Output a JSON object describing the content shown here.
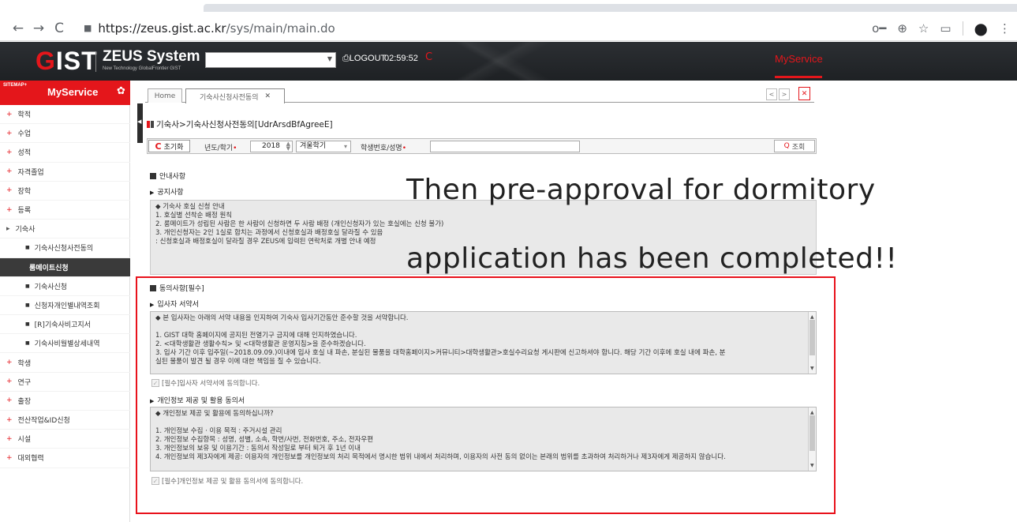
{
  "browser": {
    "url_host": "https://zeus.gist.ac.kr",
    "url_path": "/sys/main/main.do",
    "nav": {
      "back": "←",
      "forward": "→",
      "reload": "C"
    },
    "icons": {
      "key": "o━",
      "zoom": "⊕",
      "star": "☆",
      "cast": "▭",
      "account": "●",
      "menu": "⋮"
    }
  },
  "header": {
    "logo_g": "G",
    "logo_rest": "IST",
    "system_name": "ZEUS System",
    "system_sub": "New Technology GlobalFrontier GIST",
    "logout": "⎙LOGOUT",
    "timer": "02:59:52",
    "refresh_icon": "C",
    "myservice": "MyService"
  },
  "sidebar": {
    "sitemap": "SITEMAP+",
    "title": "MyService",
    "gear": "✿",
    "items": [
      {
        "label": "학적",
        "mark": "+"
      },
      {
        "label": "수업",
        "mark": "+"
      },
      {
        "label": "성적",
        "mark": "+"
      },
      {
        "label": "자격졸업",
        "mark": "+"
      },
      {
        "label": "장학",
        "mark": "+"
      },
      {
        "label": "등록",
        "mark": "+"
      },
      {
        "label": "기숙사",
        "mark": "▸"
      },
      {
        "label": "기숙사신청사전동의",
        "mark": "■"
      },
      {
        "label": "룸메이트신청",
        "mark": ""
      },
      {
        "label": "기숙사신청",
        "mark": "■"
      },
      {
        "label": "신청자개인별내역조회",
        "mark": "■"
      },
      {
        "label": "[R]기숙사비고지서",
        "mark": "■"
      },
      {
        "label": "기숙사비월별상세내역",
        "mark": "■"
      },
      {
        "label": "학생",
        "mark": "+"
      },
      {
        "label": "연구",
        "mark": "+"
      },
      {
        "label": "출장",
        "mark": "+"
      },
      {
        "label": "전산작업&ID신청",
        "mark": "+"
      },
      {
        "label": "시설",
        "mark": "+"
      },
      {
        "label": "대외협력",
        "mark": "+"
      }
    ]
  },
  "tabs": {
    "home": "Home",
    "active": "기숙사신청사전동의",
    "close": "✕",
    "prev": "<",
    "next": ">",
    "close_all": "✕"
  },
  "page": {
    "title": "기숙사>기숙사신청사전동의[UdrArsdBfAgreeE]",
    "reset": "초기화",
    "reset_icon": "C",
    "year_label": "년도/학기",
    "year_value": "2018",
    "term_value": "겨울학기",
    "student_label": "학생번호/성명",
    "search": "조회",
    "search_icon": "Q",
    "required_mark": "•"
  },
  "notice": {
    "section": "안내사항",
    "sub": "공지사항",
    "lines": [
      "◆ 기숙사 호실 신청 안내",
      "1. 호실별 선착순 배정 원칙",
      "2. 룸메이트가 성립된 사람은 한 사람이 신청하면 두 사람 배정 (개인신청자가 있는 호실에는 신청 불가)",
      "3. 개인신청자는 2인 1실로 합치는 과정에서 신청호실과 배정호실 달라질 수 있음",
      "   : 신청호실과 배정호실이 달라질 경우 ZEUS에 입력된 연락처로 개별 안내 예정"
    ]
  },
  "overlay": {
    "line1": "Then pre-approval for dormitory",
    "line2": "application has been completed!!"
  },
  "agreement": {
    "section": "동의사항[필수]",
    "pledge_sub": "입사자 서약서",
    "pledge_lines": [
      "◆ 본 입사자는 아래의 서약 내용을 인지하여 기숙사 입사기간동안 준수할 것을 서약합니다.",
      "",
      "1. GIST 대학 홈페이지에 공지된 전열기구 금지에 대해 인지하였습니다.",
      "2. <대학생활관 생활수칙> 및 <대학생활관 운영지침>을 준수하겠습니다.",
      "3. 입사 기간 이후 입주일(~2018.09.09.)이내에 입사 호실 내 파손, 분실된 물품을 대학홈페이지>커뮤니티>대학생활관>호실수리요청 게시판에 신고하셔야 합니다. 해당 기간 이후에 호실 내에 파손, 분",
      "실된 물품이 발견 될 경우 이에 대한 책임을 질 수 있습니다."
    ],
    "pledge_check": "[필수]입사자 서약서에 동의합니다.",
    "privacy_sub": "개인정보 제공 및 활용 동의서",
    "privacy_lines": [
      "◆ 개인정보 제공 및 활용에 동의하십니까?",
      "",
      "1. 개인정보 수집 · 이용 목적 :  주거시설 관리",
      "2. 개인정보 수집항목 :  성명, 성별, 소속, 학번/사번, 전화번호, 주소, 전자우편",
      "3. 개인정보의 보유 및 이용기간 : 동의서 작성일로 부터 퇴거 후 1년 이내",
      "4. 개인정보의 제3자에게 제공: 이용자의 개인정보를 개인정보의 처리 목적에서 명시한 범위 내에서 처리하며, 이용자의 사전 동의 없이는 본래의 범위를 초과하여 처리하거나 제3자에게 제공하지 않습니다."
    ],
    "privacy_check": "[필수]개인정보 제공 및 활용 동의서에 동의합니다.",
    "check_mark": "✓"
  },
  "colors": {
    "accent": "#e4161b",
    "header_bg": "#1e2124"
  }
}
